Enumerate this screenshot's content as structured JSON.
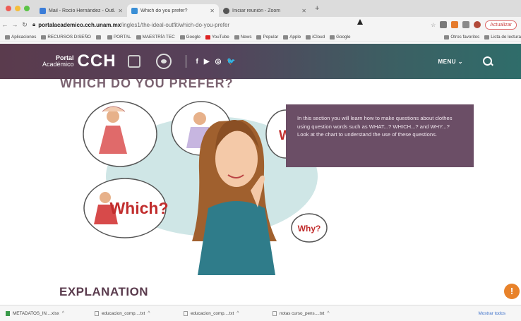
{
  "browser": {
    "tabs": [
      {
        "title": "Mail - Rocío Hernández - Outl...",
        "color": "#3b7dd8"
      },
      {
        "title": "Which do you prefer?",
        "color": "#3a8fd6"
      },
      {
        "title": "Iniciar reunión - Zoom",
        "color": "#555"
      }
    ],
    "url_domain": "portalacademico.cch.unam.mx",
    "url_path": "/ingles1/the-ideal-outfit/which-do-you-prefer",
    "update_label": "Actualizar",
    "bookmarks": [
      "Aplicaciones",
      "RECURSOS DISEÑO",
      "PORTAL",
      "MAESTRÍA TEC",
      "Google",
      "YouTube",
      "News",
      "Popular",
      "Apple",
      "iCloud",
      "Google"
    ],
    "bookmarks_right": [
      "Otros favoritos",
      "Lista de lectura"
    ]
  },
  "site": {
    "logo_top": "Portal",
    "logo_bottom": "Académico",
    "logo_cch": "CCH",
    "socials": [
      "f",
      "▶",
      "◎",
      "🐦"
    ],
    "menu_label": "MENU ⌄",
    "heading_partial": "WHICH DO YOU PREFER?",
    "bubbles": {
      "which": "Which?",
      "why": "Why?",
      "what": "Wh"
    },
    "info_text": "In this section you will learn how to make questions about clothes using question words such as WHAT...? WHICH...? and WHY...? Look at the chart to understand the use of these questions.",
    "explanation": "EXPLANATION",
    "fab": "!"
  },
  "downloads": {
    "items": [
      "METADATOS_IN....xlsx",
      "educacion_comp....txt",
      "educacion_comp....txt",
      "notas curso_pens....txt"
    ],
    "show_all": "Mostrar todos"
  },
  "colors": {
    "header_start": "#5a3b4d",
    "header_end": "#2f6d6a",
    "info_box": "#6b4e66",
    "accent": "#e8822a"
  }
}
